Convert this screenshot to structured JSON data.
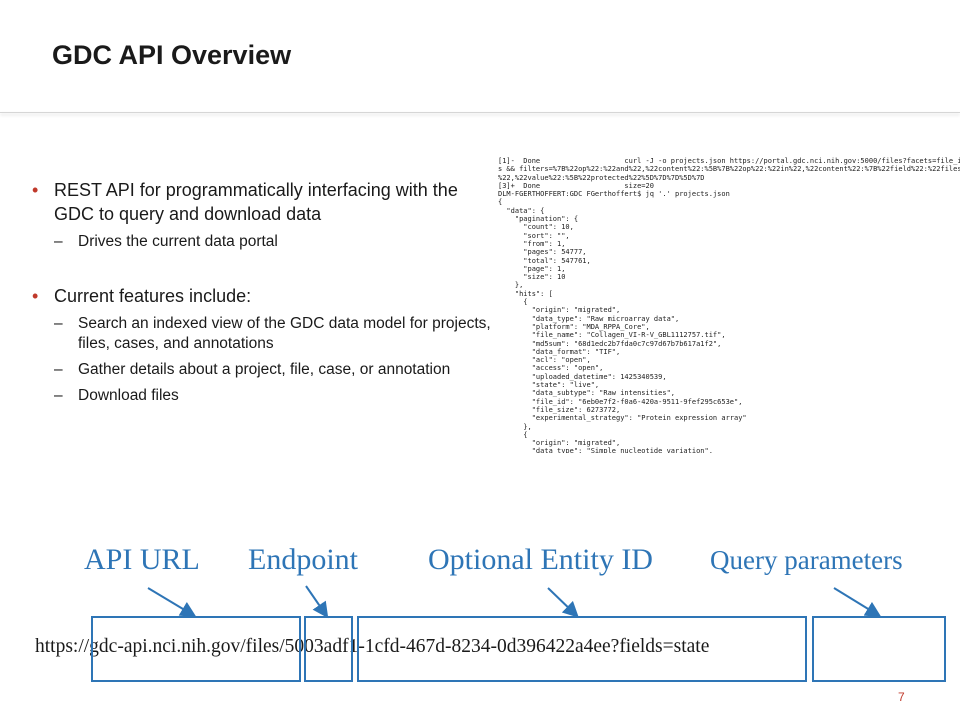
{
  "title": "GDC API Overview",
  "bullets": {
    "item1": "REST API for programmatically interfacing with the GDC to query and download data",
    "item1_sub1": "Drives the current data portal",
    "item2": "Current features include:",
    "item2_sub1": "Search an indexed view of the GDC data model for projects, files, cases, and annotations",
    "item2_sub2": "Gather details about a project, file, case, or annotation",
    "item2_sub3": "Download files",
    "bullet_glyph": "•",
    "dash_glyph": "–"
  },
  "terminal_lines": [
    "[1]-  Done                    curl -J -o projects.json https://portal.gdc.nci.nih.gov:5000/files?facets=file_id,acces",
    "s && filters=%7B%22op%22:%22and%22,%22content%22:%5B%7B%22op%22:%22in%22,%22content%22:%7B%22field%22:%22files.access",
    "%22,%22value%22:%5B%22protected%22%5D%7D%7D%5D%7D",
    "[3]+  Done                    size=20",
    "DLM-FGERTHOFFERT:GDC FGerthoffert$ jq '.' projects.json",
    "{",
    "  \"data\": {",
    "    \"pagination\": {",
    "      \"count\": 10,",
    "      \"sort\": \"\",",
    "      \"from\": 1,",
    "      \"pages\": 54777,",
    "      \"total\": 547761,",
    "      \"page\": 1,",
    "      \"size\": 10",
    "    },",
    "    \"hits\": [",
    "      {",
    "        \"origin\": \"migrated\",",
    "        \"data_type\": \"Raw microarray data\",",
    "        \"platform\": \"MDA_RPPA_Core\",",
    "        \"file_name\": \"Collagen_VI-R-V_GBL1112757.tif\",",
    "        \"md5sum\": \"68d1edc2b7fda0c7c97d67b7b617a1f2\",",
    "        \"data_format\": \"TIF\",",
    "        \"acl\": \"open\",",
    "        \"access\": \"open\",",
    "        \"uploaded_datetime\": 1425340539,",
    "        \"state\": \"live\",",
    "        \"data_subtype\": \"Raw intensities\",",
    "        \"file_id\": \"6eb0e7f2-f0a6-420a-9511-9fef295c653e\",",
    "        \"file_size\": 6273772,",
    "        \"experimental_strategy\": \"Protein expression array\"",
    "      },",
    "      {",
    "        \"origin\": \"migrated\",",
    "        \"data_type\": \"Simple nucleotide variation\","
  ],
  "labels": {
    "api_url": "API URL",
    "endpoint": "Endpoint",
    "entity_id": "Optional Entity ID",
    "query_params": "Query parameters"
  },
  "url_text": "https://gdc-api.nci.nih.gov/files/5003adf1-1cfd-467d-8234-0d396422a4ee?fields=state",
  "page_number": "7",
  "colors": {
    "accent_blue": "#2e75b6",
    "bullet_red": "#c0392b"
  }
}
